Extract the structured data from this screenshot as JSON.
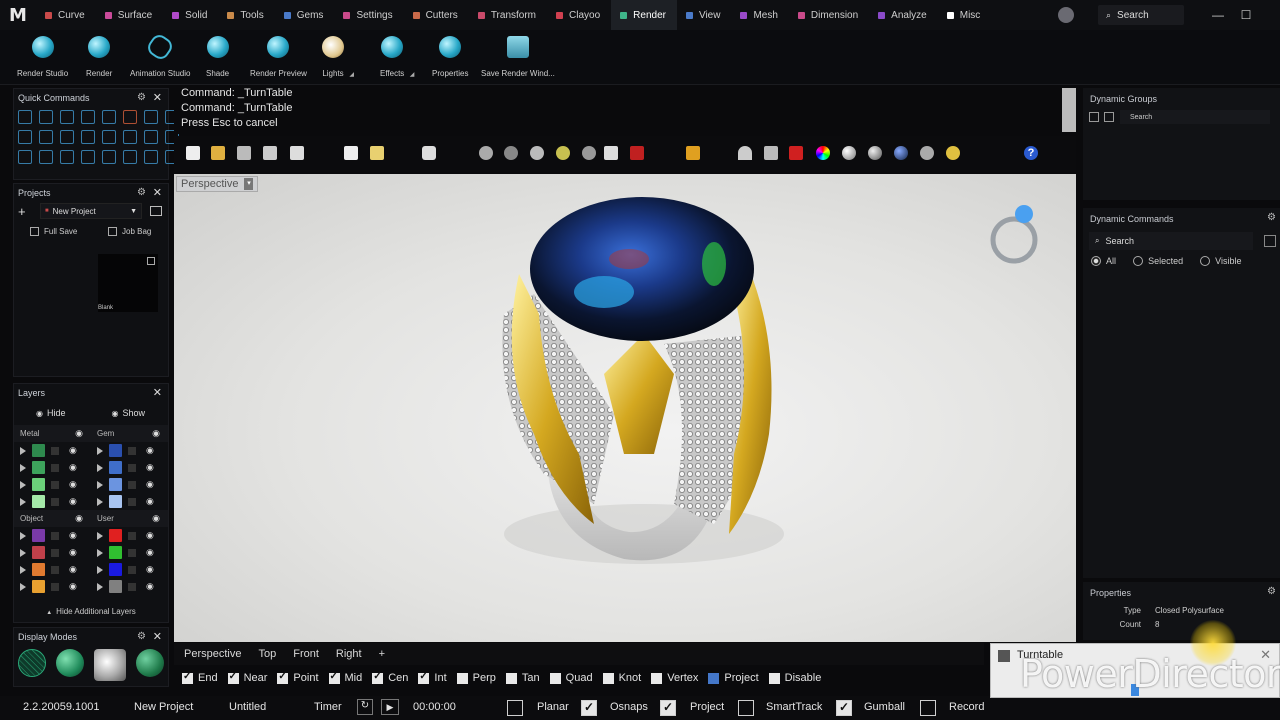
{
  "app": {
    "logo": "M"
  },
  "menu": {
    "tabs": [
      {
        "label": "Curve",
        "color": "#c94a4a"
      },
      {
        "label": "Surface",
        "color": "#c94a9a"
      },
      {
        "label": "Solid",
        "color": "#b04ac9"
      },
      {
        "label": "Tools",
        "color": "#c98a4a"
      },
      {
        "label": "Gems",
        "color": "#4a7ac9"
      },
      {
        "label": "Settings",
        "color": "#c94a8a"
      },
      {
        "label": "Cutters",
        "color": "#c96a4a"
      },
      {
        "label": "Transform",
        "color": "#c94a6a"
      },
      {
        "label": "Clayoo",
        "color": "#d04050"
      },
      {
        "label": "Render",
        "color": "#3fb58a"
      },
      {
        "label": "View",
        "color": "#4a7ac9"
      },
      {
        "label": "Mesh",
        "color": "#9a4ac9"
      },
      {
        "label": "Dimension",
        "color": "#c94a8a"
      },
      {
        "label": "Analyze",
        "color": "#8a4ac9"
      },
      {
        "label": "Misc",
        "color": "#ffffff"
      }
    ],
    "active": "Render",
    "search": "Search",
    "win": [
      "—",
      "☐"
    ]
  },
  "ribbon": {
    "buttons": [
      "Render Studio",
      "Render",
      "Animation Studio",
      "Shade",
      "Render Preview",
      "Lights",
      "Effects",
      "Properties",
      "Save Render Wind..."
    ]
  },
  "quick_commands": {
    "title": "Quick Commands"
  },
  "projects": {
    "title": "Projects",
    "dropdown": "New Project",
    "full_save": "Full Save",
    "job_bag": "Job Bag",
    "thumb_label": "Blank"
  },
  "layers": {
    "title": "Layers",
    "hide": "Hide",
    "show": "Show",
    "groups": [
      {
        "name": "Metal",
        "colors": [
          "#2e8a4e",
          "#3da35c",
          "#6bd07a",
          "#a4e8a8"
        ]
      },
      {
        "name": "Gem",
        "colors": [
          "#2a4fae",
          "#3f6ec9",
          "#6b94e0",
          "#a8c4f0"
        ]
      },
      {
        "name": "Object",
        "colors": [
          "#7a3aa8",
          "#c0404a",
          "#e07a30",
          "#e8a030"
        ]
      },
      {
        "name": "User",
        "colors": [
          "#e02020",
          "#30c030",
          "#1a1ae0",
          "#808080"
        ]
      }
    ],
    "hide_additional": "Hide Additional Layers"
  },
  "display_modes": {
    "title": "Display Modes"
  },
  "command": {
    "line1": "Command: _TurnTable",
    "line2": "Command: _TurnTable",
    "line3": "Press Esc to cancel"
  },
  "viewport": {
    "label": "Perspective"
  },
  "view_tabs": [
    "Perspective",
    "Top",
    "Front",
    "Right",
    "+"
  ],
  "osnaps": [
    {
      "label": "End",
      "on": true
    },
    {
      "label": "Near",
      "on": true
    },
    {
      "label": "Point",
      "on": true
    },
    {
      "label": "Mid",
      "on": true
    },
    {
      "label": "Cen",
      "on": true
    },
    {
      "label": "Int",
      "on": true
    },
    {
      "label": "Perp",
      "on": false
    },
    {
      "label": "Tan",
      "on": false
    },
    {
      "label": "Quad",
      "on": false
    },
    {
      "label": "Knot",
      "on": false
    },
    {
      "label": "Vertex",
      "on": false
    },
    {
      "label": "Project",
      "on": false,
      "blue": true
    },
    {
      "label": "Disable",
      "on": false
    }
  ],
  "status": {
    "version": "2.2.20059.1001",
    "project": "New Project",
    "file": "Untitled",
    "timer": "Timer",
    "time": "00:00:00",
    "planar": "Planar",
    "osnaps": "Osnaps",
    "project_toggle": "Project",
    "smarttrack": "SmartTrack",
    "gumball": "Gumball",
    "record": "Record"
  },
  "right": {
    "dynamic_groups": "Dynamic Groups",
    "groups_search": "Search",
    "dynamic_commands": "Dynamic Commands",
    "commands_search": "Search",
    "filters": [
      "All",
      "Selected",
      "Visible"
    ],
    "properties": "Properties",
    "props": [
      {
        "k": "Type",
        "v": "Closed Polysurface"
      },
      {
        "k": "Count",
        "v": "8"
      }
    ]
  },
  "turntable": {
    "title": "Turntable"
  },
  "watermark": "PowerDirector"
}
